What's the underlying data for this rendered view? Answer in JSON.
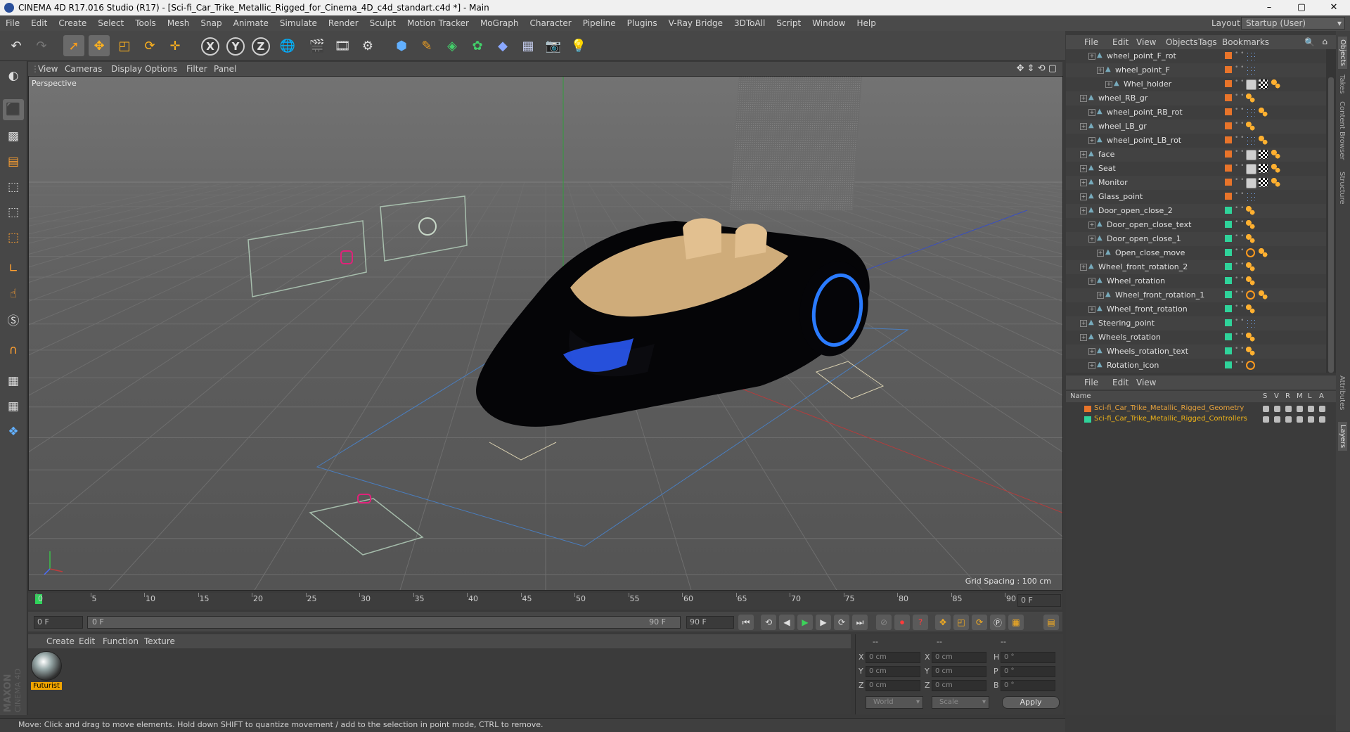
{
  "window": {
    "title": "CINEMA 4D R17.016 Studio (R17) - [Sci-fi_Car_Trike_Metallic_Rigged_for_Cinema_4D_c4d_standart.c4d *] - Main",
    "controls": [
      "–",
      "▢",
      "✕"
    ]
  },
  "menubar": [
    "File",
    "Edit",
    "Create",
    "Select",
    "Tools",
    "Mesh",
    "Snap",
    "Animate",
    "Simulate",
    "Render",
    "Sculpt",
    "Motion Tracker",
    "MoGraph",
    "Character",
    "Pipeline",
    "Plugins",
    "V-Ray Bridge",
    "3DToAll",
    "Script",
    "Window",
    "Help"
  ],
  "layout": {
    "label": "Layout:",
    "value": "Startup (User)"
  },
  "toolbar": {
    "axis_x": "X",
    "axis_y": "Y",
    "axis_z": "Z"
  },
  "viewport": {
    "menu": [
      "View",
      "Cameras",
      "Display",
      "Options",
      "Filter",
      "Panel"
    ],
    "camera_label": "Perspective",
    "grid_spacing": "Grid Spacing : 100 cm"
  },
  "timeline": {
    "ticks": [
      "0",
      "5",
      "10",
      "15",
      "20",
      "25",
      "30",
      "35",
      "40",
      "45",
      "50",
      "55",
      "60",
      "65",
      "70",
      "75",
      "80",
      "85",
      "90"
    ],
    "current_frame": "0 F",
    "start_field": "0 F",
    "range_start": "0 F",
    "range_end": "90 F",
    "end_field": "90 F"
  },
  "material_manager": {
    "menu": [
      "Create",
      "Edit",
      "Function",
      "Texture"
    ],
    "materials": [
      {
        "name": "Futurist"
      }
    ]
  },
  "coordinates": {
    "headers": [
      "--",
      "--",
      "--"
    ],
    "rows": [
      {
        "l1": "X",
        "v1": "0 cm",
        "l2": "X",
        "v2": "0 cm",
        "l3": "H",
        "v3": "0 °"
      },
      {
        "l1": "Y",
        "v1": "0 cm",
        "l2": "Y",
        "v2": "0 cm",
        "l3": "P",
        "v3": "0 °"
      },
      {
        "l1": "Z",
        "v1": "0 cm",
        "l2": "Z",
        "v2": "0 cm",
        "l3": "B",
        "v3": "0 °"
      }
    ],
    "space": "World",
    "mode": "Scale",
    "apply": "Apply"
  },
  "status": "Move: Click and drag to move elements. Hold down SHIFT to quantize movement / add to the selection in point mode, CTRL to remove.",
  "object_manager": {
    "menu": [
      "File",
      "Edit",
      "View",
      "Objects",
      "Tags",
      "Bookmarks"
    ],
    "objects": [
      {
        "name": "wheel_point_F_rot",
        "indent": 2,
        "layer": "#e8742a",
        "tags": [
          "dots"
        ]
      },
      {
        "name": "wheel_point_F",
        "indent": 3,
        "layer": "#e8742a",
        "tags": [
          "dots"
        ]
      },
      {
        "name": "Whel_holder",
        "indent": 4,
        "layer": "#e8742a",
        "tags": [
          "phong",
          "checker",
          "mat"
        ]
      },
      {
        "name": "wheel_RB_gr",
        "indent": 1,
        "layer": "#e8742a",
        "tags": [
          "mat"
        ]
      },
      {
        "name": "wheel_point_RB_rot",
        "indent": 2,
        "layer": "#e8742a",
        "tags": [
          "dots",
          "mat"
        ]
      },
      {
        "name": "wheel_LB_gr",
        "indent": 1,
        "layer": "#e8742a",
        "tags": [
          "mat"
        ]
      },
      {
        "name": "wheel_point_LB_rot",
        "indent": 2,
        "layer": "#e8742a",
        "tags": [
          "dots",
          "mat"
        ]
      },
      {
        "name": "face",
        "indent": 1,
        "layer": "#e8742a",
        "tags": [
          "phong",
          "checker",
          "mat"
        ]
      },
      {
        "name": "Seat",
        "indent": 1,
        "layer": "#e8742a",
        "tags": [
          "phong",
          "checker",
          "mat"
        ]
      },
      {
        "name": "Monitor",
        "indent": 1,
        "layer": "#e8742a",
        "tags": [
          "phong",
          "checker",
          "mat"
        ]
      },
      {
        "name": "Glass_point",
        "indent": 1,
        "layer": "#e8742a",
        "tags": [
          "dots"
        ]
      },
      {
        "name": "Door_open_close_2",
        "indent": 1,
        "layer": "#2fd39a",
        "tags": [
          "mat"
        ]
      },
      {
        "name": "Door_open_close_text",
        "indent": 2,
        "layer": "#2fd39a",
        "tags": [
          "mat"
        ]
      },
      {
        "name": "Door_open_close_1",
        "indent": 2,
        "layer": "#2fd39a",
        "tags": [
          "mat"
        ]
      },
      {
        "name": "Open_close_move",
        "indent": 3,
        "layer": "#2fd39a",
        "tags": [
          "nope",
          "mat"
        ]
      },
      {
        "name": "Wheel_front_rotation_2",
        "indent": 1,
        "layer": "#2fd39a",
        "tags": [
          "mat"
        ]
      },
      {
        "name": "Wheel_rotation",
        "indent": 2,
        "layer": "#2fd39a",
        "tags": [
          "mat"
        ]
      },
      {
        "name": "Wheel_front_rotation_1",
        "indent": 3,
        "layer": "#2fd39a",
        "tags": [
          "nope",
          "mat"
        ]
      },
      {
        "name": "Wheel_front_rotation",
        "indent": 2,
        "layer": "#2fd39a",
        "tags": [
          "mat"
        ]
      },
      {
        "name": "Steering_point",
        "indent": 1,
        "layer": "#2fd39a",
        "tags": [
          "dots"
        ]
      },
      {
        "name": "Wheels_rotation",
        "indent": 1,
        "layer": "#2fd39a",
        "tags": [
          "mat"
        ]
      },
      {
        "name": "Wheels_rotation_text",
        "indent": 2,
        "layer": "#2fd39a",
        "tags": [
          "mat"
        ]
      },
      {
        "name": "Rotation_icon",
        "indent": 2,
        "layer": "#2fd39a",
        "tags": [
          "nope"
        ]
      }
    ]
  },
  "layer_manager": {
    "menu": [
      "File",
      "Edit",
      "View"
    ],
    "headers": {
      "name": "Name",
      "flags": [
        "S",
        "V",
        "R",
        "M",
        "L",
        "A"
      ]
    },
    "layers": [
      {
        "name": "Sci-fi_Car_Trike_Metallic_Rigged_Geometry",
        "color": "#e8742a",
        "text_color": "#e6a23c"
      },
      {
        "name": "Sci-fi_Car_Trike_Metallic_Rigged_Controllers",
        "color": "#2fd39a",
        "text_color": "#f0b418"
      }
    ]
  },
  "side_tabs": [
    "Objects",
    "Takes",
    "Content Browser",
    "Structure",
    "Attributes",
    "Layers"
  ]
}
